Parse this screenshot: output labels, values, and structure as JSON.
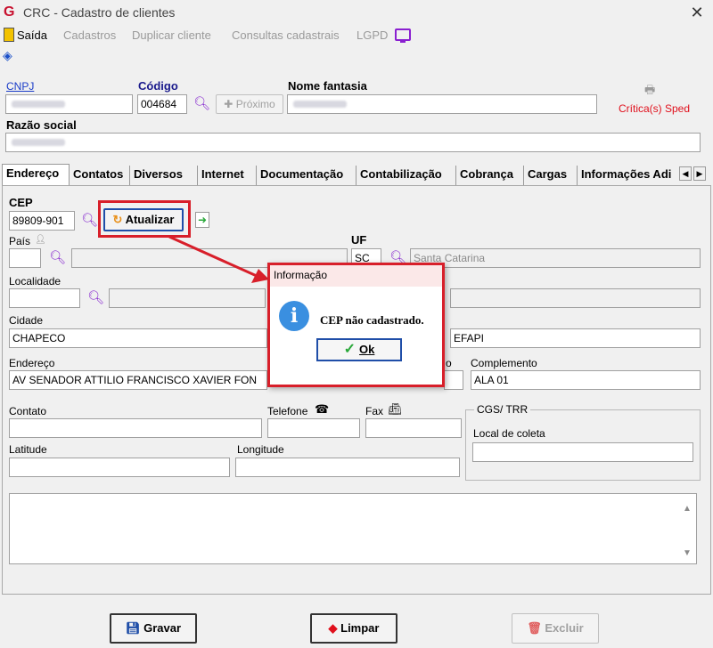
{
  "window": {
    "title": "CRC - Cadastro de clientes",
    "logo": "G",
    "close": "✕"
  },
  "menu": {
    "exit": "Saída",
    "cadastros": "Cadastros",
    "duplicar": "Duplicar cliente",
    "consultas": "Consultas cadastrais",
    "lgpd": "LGPD"
  },
  "header": {
    "cnpj_label": "CNPJ",
    "cnpj_value": "",
    "codigo_label": "Código",
    "codigo_value": "004684",
    "proximo_label": "Próximo",
    "nome_fantasia_label": "Nome fantasia",
    "nome_fantasia_value": "",
    "criticas_label": "Crítica(s) Sped",
    "razao_social_label": "Razão social",
    "razao_social_value": ""
  },
  "tabs": [
    "Endereço",
    "Contatos",
    "Diversos",
    "Internet",
    "Documentação",
    "Contabilização",
    "Cobrança",
    "Cargas",
    "Informações Adi"
  ],
  "address": {
    "cep_label": "CEP",
    "cep_value": "89809-901",
    "atualizar_label": "Atualizar",
    "pais_label": "País",
    "uf_label": "UF",
    "uf_value": "SC",
    "estado_value": "Santa Catarina",
    "localidade_label": "Localidade",
    "cidade_label": "Cidade",
    "cidade_value": "CHAPECO",
    "bairro_value": "EFAPI",
    "endereco_label": "Endereço",
    "endereco_value": "AV SENADOR ATTILIO FRANCISCO XAVIER FON",
    "numero_label_partial": "o",
    "complemento_label": "Complemento",
    "complemento_value": "ALA 01",
    "contato_label": "Contato",
    "telefone_label": "Telefone",
    "fax_label": "Fax",
    "cgs_label": "CGS/ TRR",
    "local_coleta_label": "Local de coleta",
    "latitude_label": "Latitude",
    "longitude_label": "Longitude"
  },
  "dialog": {
    "title": "Informação",
    "message": "CEP não cadastrado.",
    "ok_label": "Ok",
    "ok_underlined": "O"
  },
  "footer": {
    "gravar": "Gravar",
    "limpar": "Limpar",
    "excluir": "Excluir"
  },
  "colors": {
    "highlight": "#d81f2a",
    "accent_purple": "#8a2fd0",
    "info_blue": "#3a8fe0"
  }
}
